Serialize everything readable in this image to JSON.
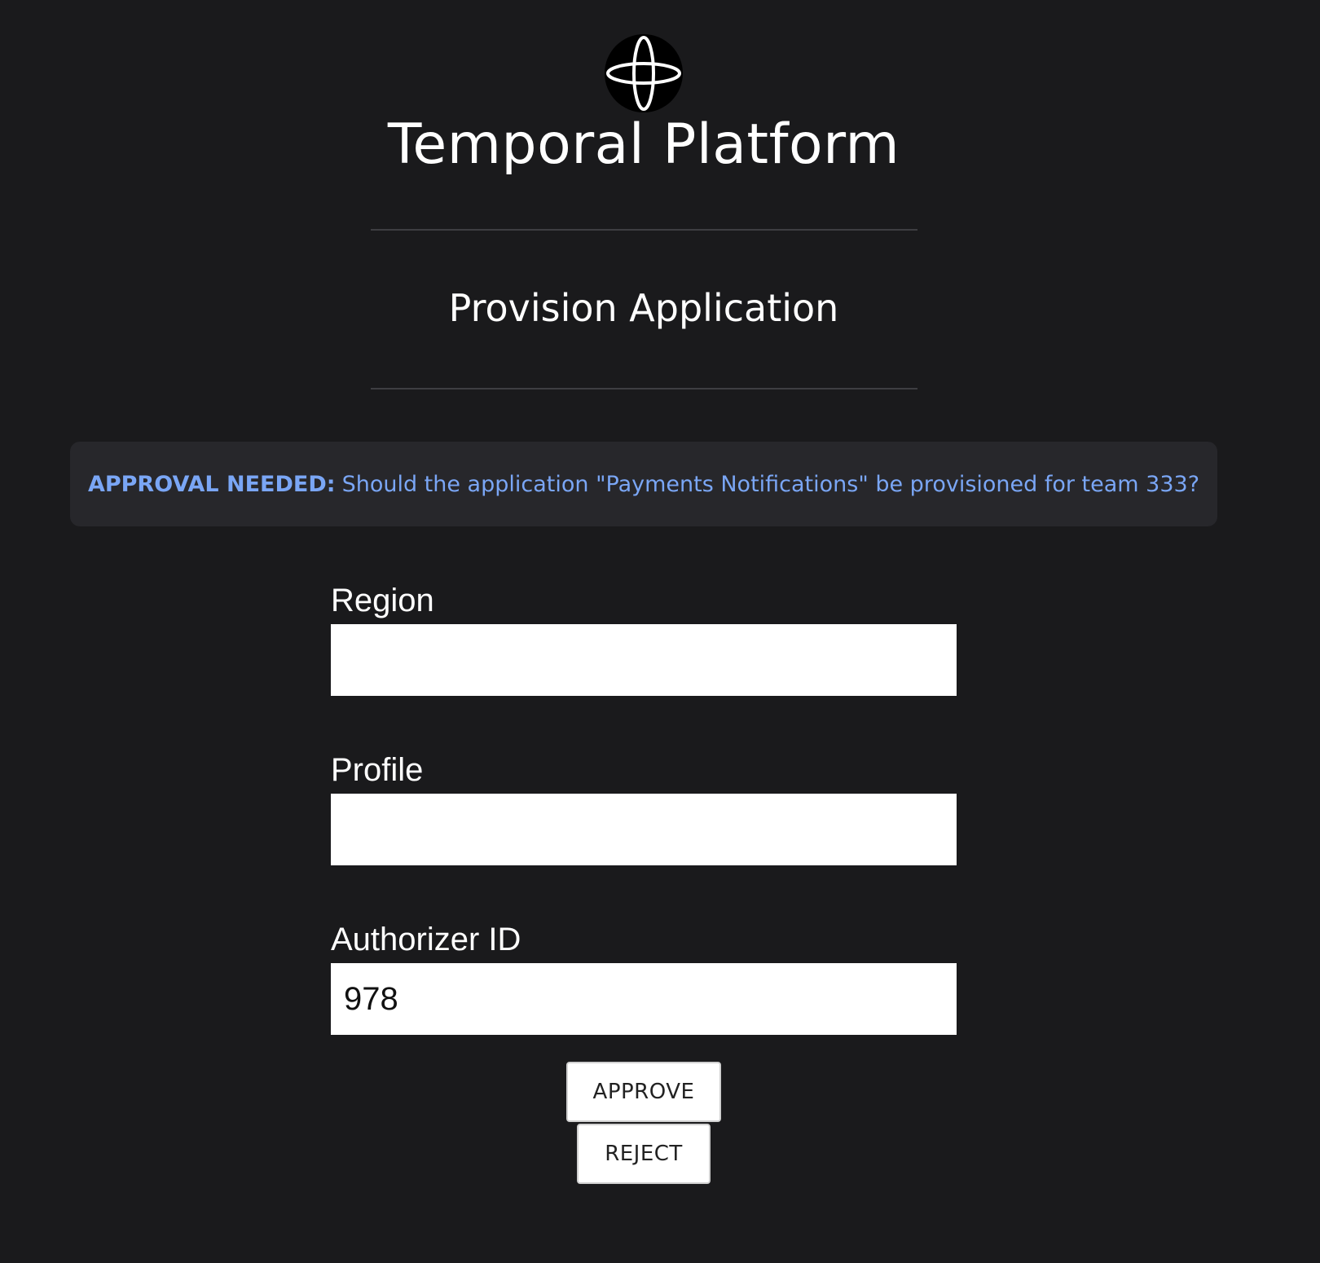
{
  "header": {
    "logo_icon": "temporal-logo-icon",
    "app_title": "Temporal Platform",
    "page_title": "Provision Application"
  },
  "alert": {
    "label": "APPROVAL NEEDED:",
    "message": "Should the application \"Payments Notifications\" be provisioned for team 333?",
    "color": "#7aa6f5"
  },
  "form": {
    "region": {
      "label": "Region",
      "value": ""
    },
    "profile": {
      "label": "Profile",
      "value": ""
    },
    "authorizer": {
      "label": "Authorizer ID",
      "value": "978"
    }
  },
  "actions": {
    "approve_label": "APPROVE",
    "reject_label": "REJECT"
  }
}
